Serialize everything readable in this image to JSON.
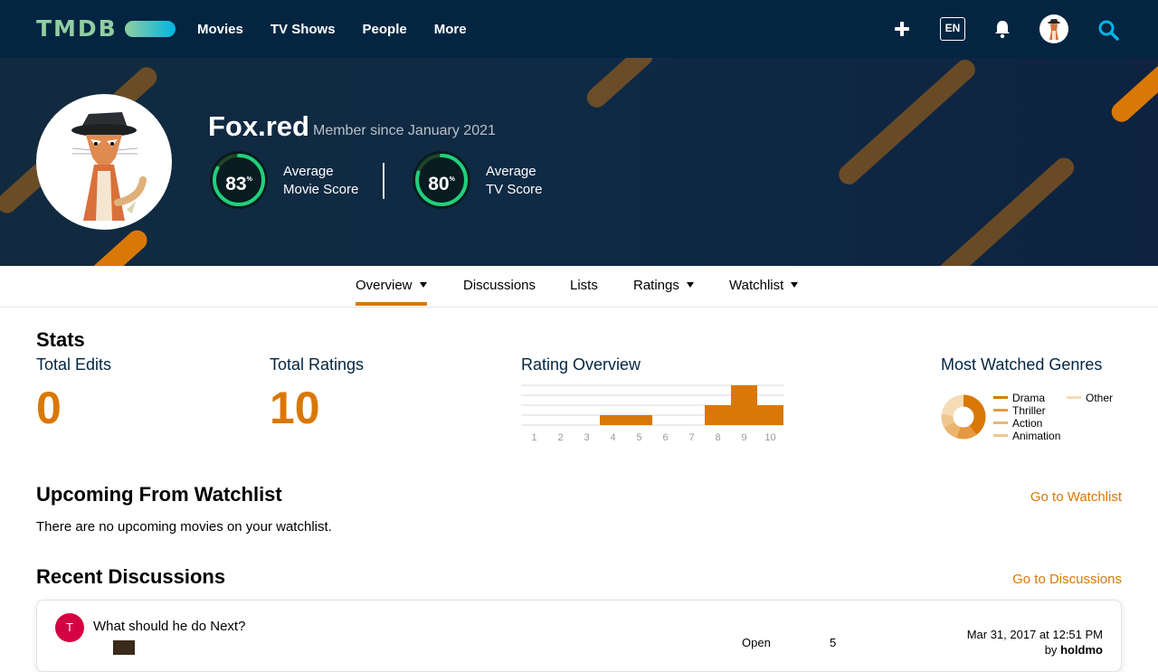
{
  "nav": {
    "logo": "TMDB",
    "links": [
      "Movies",
      "TV Shows",
      "People",
      "More"
    ],
    "language": "EN",
    "icons": {
      "add": "plus-icon",
      "notifications": "bell-icon",
      "search": "search-icon"
    }
  },
  "profile": {
    "username": "Fox.red",
    "member_since": "Member since January 2021",
    "movie_score": {
      "value": "83",
      "pct": 83,
      "label_line1": "Average",
      "label_line2": "Movie Score"
    },
    "tv_score": {
      "value": "80",
      "pct": 80,
      "label_line1": "Average",
      "label_line2": "TV Score"
    }
  },
  "subnav": {
    "items": [
      "Overview",
      "Discussions",
      "Lists",
      "Ratings",
      "Watchlist"
    ],
    "active": "Overview"
  },
  "stats": {
    "title": "Stats",
    "total_edits_label": "Total Edits",
    "total_edits": "0",
    "total_ratings_label": "Total Ratings",
    "total_ratings": "10",
    "rating_overview_label": "Rating Overview",
    "genres_label": "Most Watched Genres"
  },
  "chart_data": [
    {
      "type": "bar",
      "title": "Rating Overview",
      "categories": [
        "1",
        "2",
        "3",
        "4",
        "5",
        "6",
        "7",
        "8",
        "9",
        "10"
      ],
      "values": [
        0,
        0,
        0,
        1,
        1,
        0,
        0,
        2,
        4,
        2
      ],
      "ylim": [
        0,
        4
      ],
      "grid": true
    },
    {
      "type": "pie",
      "title": "Most Watched Genres",
      "labels": [
        "Drama",
        "Thriller",
        "Action",
        "Animation",
        "Other"
      ],
      "values": [
        40,
        15,
        12,
        10,
        23
      ],
      "colors": [
        "#d97806",
        "#e39a40",
        "#ebb56f",
        "#f0c68f",
        "#f5dcb5"
      ]
    }
  ],
  "watchlist": {
    "title": "Upcoming From Watchlist",
    "link": "Go to Watchlist",
    "empty_text": "There are no upcoming movies on your watchlist."
  },
  "discussions": {
    "title": "Recent Discussions",
    "link": "Go to Discussions",
    "items": [
      {
        "avatar_letter": "T",
        "title": "What should he do Next?",
        "status": "Open",
        "replies": "5",
        "date": "Mar 31, 2017 at 12:51 PM",
        "by_prefix": "by",
        "by_user": "holdmo"
      }
    ]
  },
  "colors": {
    "nav_bg": "#032541",
    "accent": "#d97806",
    "score_ring": "#21d07a",
    "avatar_bg": "#d40242"
  }
}
